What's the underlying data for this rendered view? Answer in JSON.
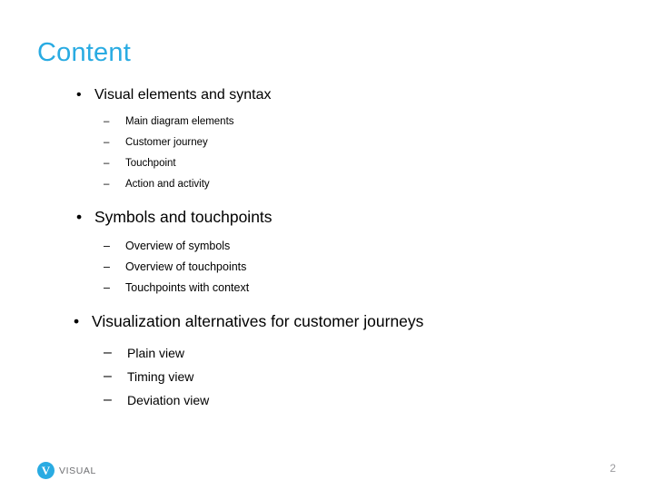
{
  "slide": {
    "title": "Content",
    "title_color": "#29abe2",
    "background_color": "#ffffff",
    "bullet_marker": "•",
    "dash_marker": "–",
    "sections": [
      {
        "heading": "Visual elements and syntax",
        "items": [
          "Main diagram elements",
          "Customer journey",
          "Touchpoint",
          "Action and activity"
        ]
      },
      {
        "heading": "Symbols and touchpoints",
        "items": [
          "Overview of symbols",
          "Overview of touchpoints",
          "Touchpoints with context"
        ]
      },
      {
        "heading": "Visualization alternatives for customer journeys",
        "items": [
          "Plain view",
          "Timing view",
          "Deviation view"
        ]
      }
    ]
  },
  "footer": {
    "logo_letter": "V",
    "logo_text": "VISUAL",
    "logo_color": "#29abe2",
    "logo_text_color": "#6d6e71",
    "page_number": "2",
    "page_number_color": "#9a9a9e"
  }
}
